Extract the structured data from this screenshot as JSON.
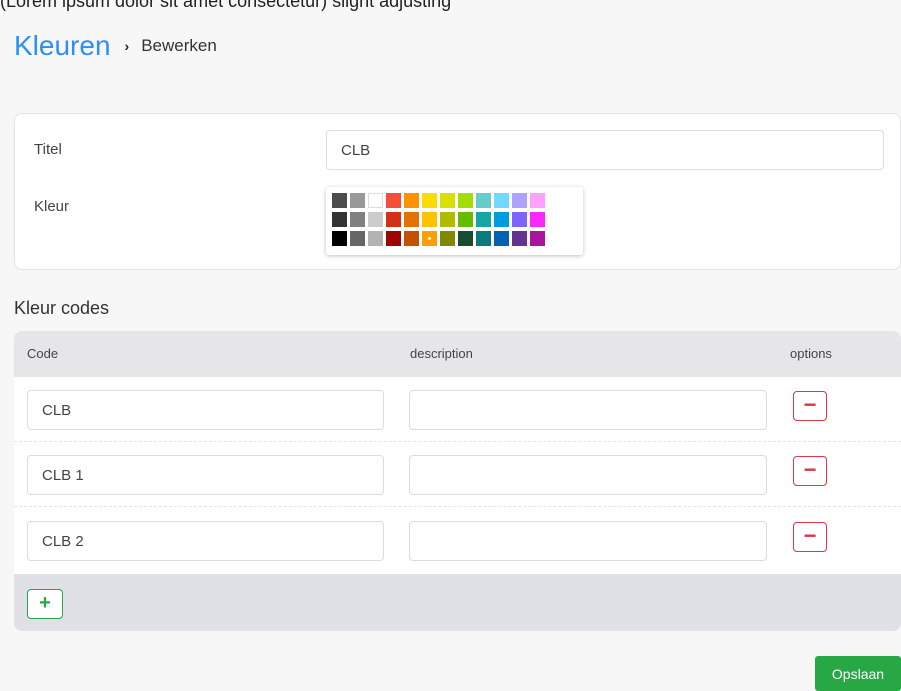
{
  "top_clip_text": "(Lorem ipsum dolor sit amet consectetur) slight adjusting",
  "breadcrumb": {
    "root": "Kleuren",
    "separator": "›",
    "current": "Bewerken"
  },
  "form": {
    "title_label": "Titel",
    "title_value": "CLB",
    "color_label": "Kleur",
    "palette": [
      [
        "#4d4d4d",
        "#999999",
        "#ffffff",
        "#f44e3b",
        "#fe9200",
        "#fcdc00",
        "#dbdf00",
        "#a4dd00",
        "#68ccca",
        "#73d8ff",
        "#aea1ff",
        "#fda1ff"
      ],
      [
        "#333333",
        "#808080",
        "#cccccc",
        "#d33115",
        "#e27300",
        "#fcc400",
        "#b0bc00",
        "#68bc00",
        "#16a5a5",
        "#009ce0",
        "#7b64ff",
        "#fa28ff"
      ],
      [
        "#000000",
        "#666666",
        "#b3b3b3",
        "#9f0500",
        "#c45100",
        "#fb9e00",
        "#808900",
        "#194d33",
        "#0c797d",
        "#0062b1",
        "#653294",
        "#ab149e"
      ]
    ],
    "selected_color": "#fb9e00"
  },
  "codes": {
    "section_title": "Kleur codes",
    "headers": {
      "code": "Code",
      "description": "description",
      "options": "options"
    },
    "rows": [
      {
        "code": "CLB",
        "description": ""
      },
      {
        "code": "CLB 1",
        "description": ""
      },
      {
        "code": "CLB 2",
        "description": ""
      }
    ],
    "remove_symbol": "−",
    "add_symbol": "+"
  },
  "save_label": "Opslaan",
  "colors": {
    "accent_blue": "#2e8ff0",
    "danger": "#dc3545",
    "success": "#28a745"
  }
}
